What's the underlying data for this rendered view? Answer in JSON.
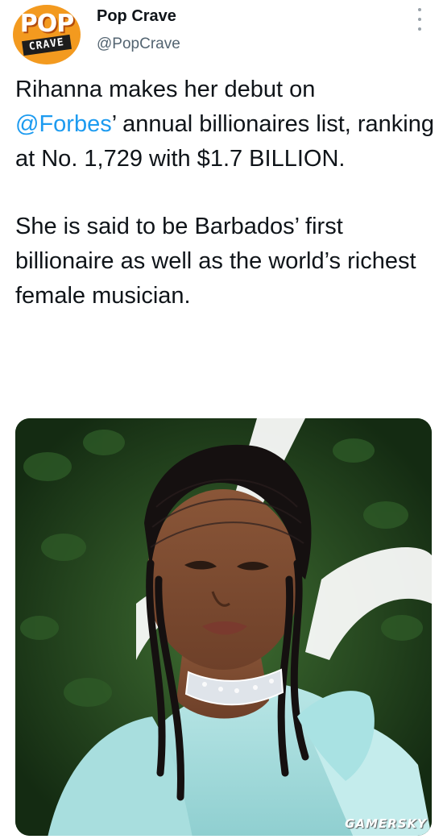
{
  "author": {
    "avatar_logo_top": "POP",
    "avatar_logo_bottom": "CRAVE",
    "display_name": "Pop Crave",
    "handle": "@PopCrave"
  },
  "tweet": {
    "p1_before": "Rihanna makes her debut on",
    "p1_mention": "@Forbes",
    "p1_after": "’ annual billionaires list, ranking at No. 1,729 with $1.7 BILLION.",
    "p2": "She is said to be Barbados’ first billionaire as well as the world’s richest female musician."
  },
  "media": {
    "watermark": "GAMERSKY"
  },
  "colors": {
    "accent": "#1d9bf0",
    "avatar_bg": "#f39a1f",
    "secondary_text": "#536471"
  },
  "icons": {
    "more": "more-vertical-icon"
  }
}
